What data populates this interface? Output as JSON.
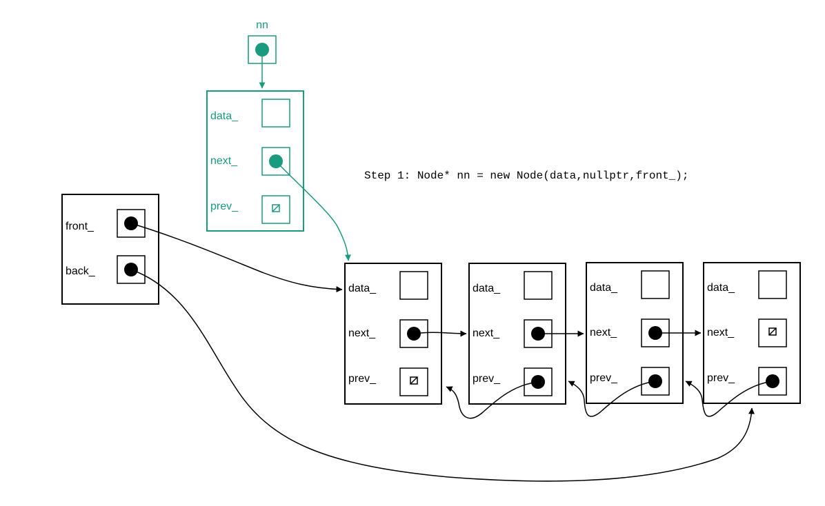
{
  "colors": {
    "ink": "#000000",
    "accent": "#1a9a7e",
    "background": "#ffffff"
  },
  "caption": "Step 1: Node* nn = new Node(data,nullptr,front_);",
  "new_node": {
    "pointer_label": "nn",
    "fields": [
      "data_",
      "next_",
      "prev_"
    ]
  },
  "list": {
    "fields": [
      "front_",
      "back_"
    ]
  },
  "nodes": [
    {
      "fields": [
        "data_",
        "next_",
        "prev_"
      ]
    },
    {
      "fields": [
        "data_",
        "next_",
        "prev_"
      ]
    },
    {
      "fields": [
        "data_",
        "next_",
        "prev_"
      ]
    },
    {
      "fields": [
        "data_",
        "next_",
        "prev_"
      ]
    }
  ],
  "icons": {
    "pointer": "filled-dot-icon",
    "null": "null-pointer-icon"
  }
}
